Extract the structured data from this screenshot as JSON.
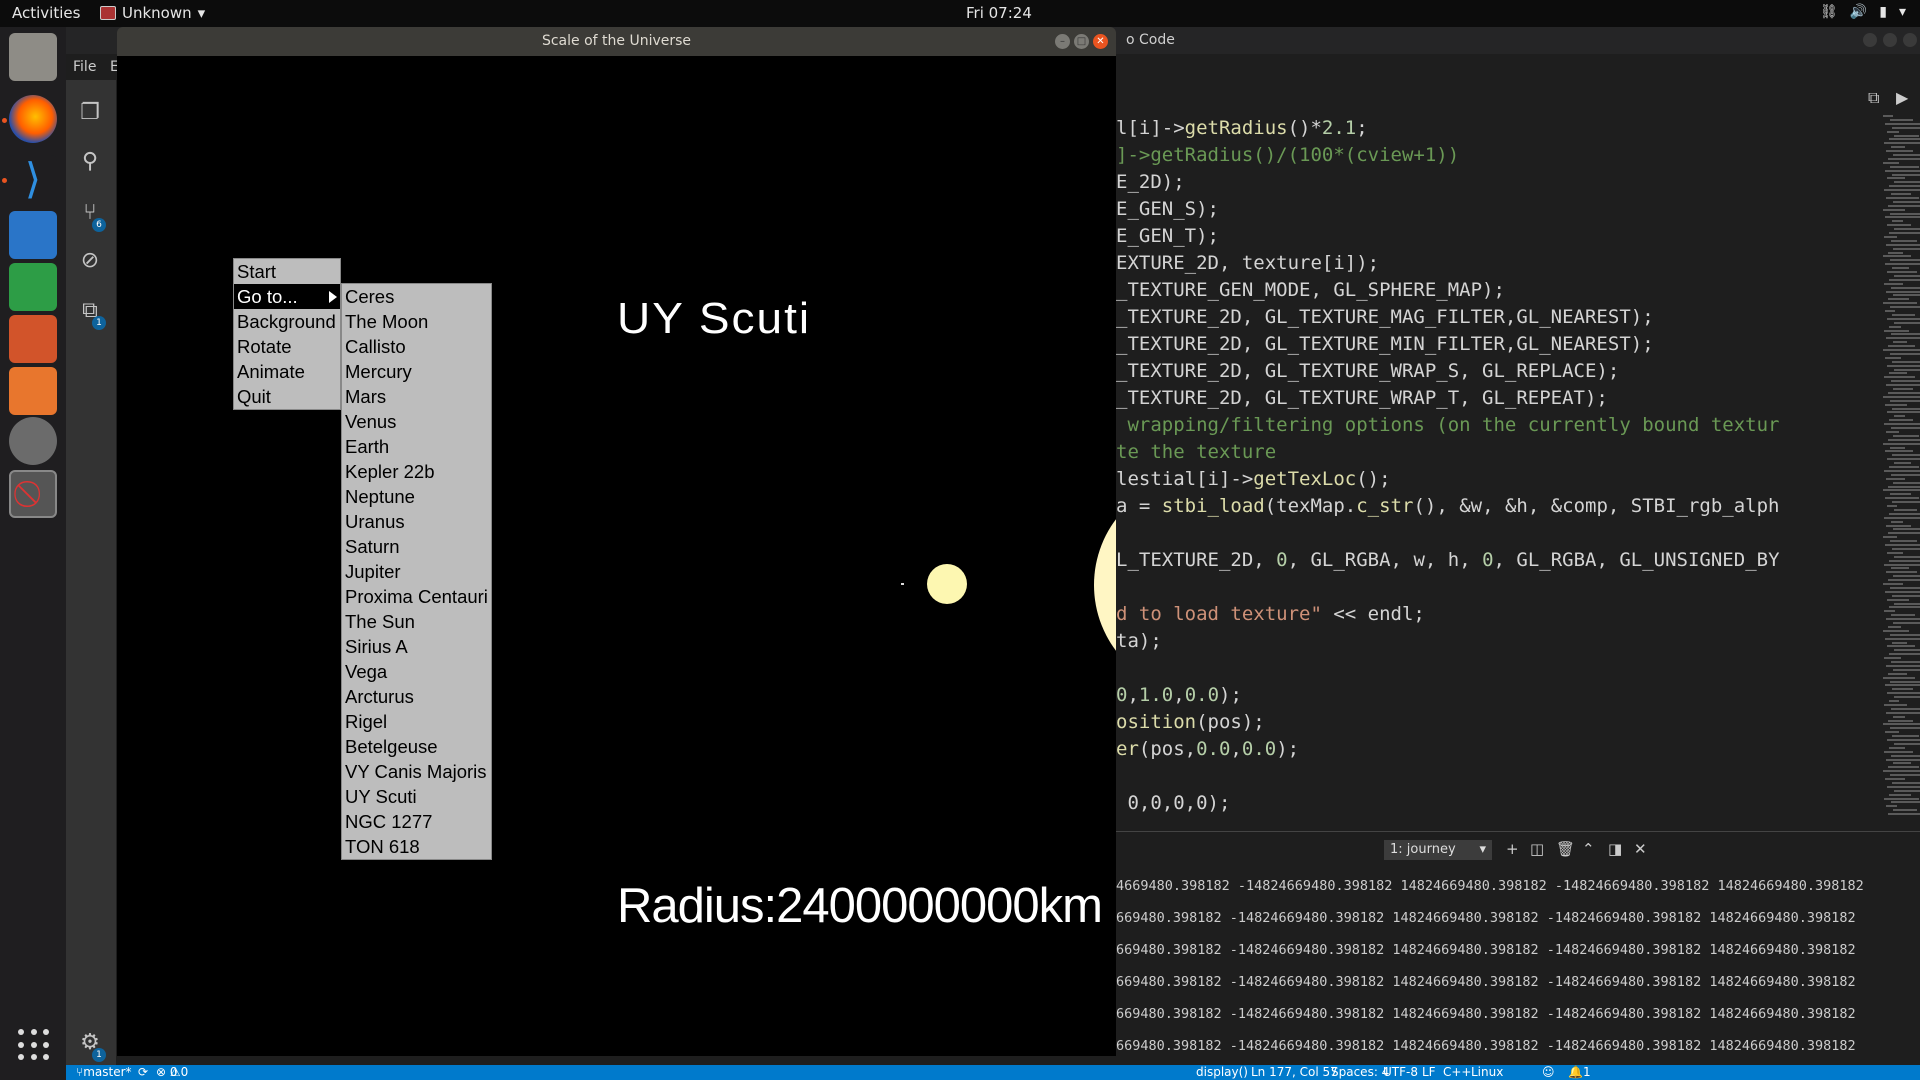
{
  "topbar": {
    "activities": "Activities",
    "app_name": "Unknown",
    "clock": "Fri 07:24",
    "tray": [
      "network-icon",
      "volume-icon",
      "battery-icon",
      "menu-arrow-icon"
    ]
  },
  "dock": {
    "items": [
      "files-icon",
      "firefox-icon",
      "vscode-icon",
      "writer-icon",
      "calc-icon",
      "impress-icon",
      "software-icon",
      "settings-icon",
      "app-blocked-icon"
    ]
  },
  "vscode": {
    "title": "o Code",
    "menu": [
      "File",
      "E"
    ],
    "activity_badges": {
      "source_control": "6",
      "extensions": "1",
      "settings": "1"
    },
    "code_lines": [
      {
        "parts": [
          [
            "plain",
            "l[i]->"
          ],
          [
            "fn",
            "getRadius"
          ],
          [
            "plain",
            "()*"
          ],
          [
            "num",
            "2.1"
          ],
          [
            "plain",
            ";"
          ]
        ]
      },
      {
        "parts": [
          [
            "cm",
            "]->getRadius()/(100*(cview+1))"
          ]
        ]
      },
      {
        "parts": [
          [
            "plain",
            "E_2D);"
          ]
        ]
      },
      {
        "parts": [
          [
            "plain",
            "E_GEN_S);"
          ]
        ]
      },
      {
        "parts": [
          [
            "plain",
            "E_GEN_T);"
          ]
        ]
      },
      {
        "parts": [
          [
            "plain",
            "EXTURE_2D, texture[i]);"
          ]
        ]
      },
      {
        "parts": [
          [
            "plain",
            "_TEXTURE_GEN_MODE, GL_SPHERE_MAP);"
          ]
        ]
      },
      {
        "parts": [
          [
            "plain",
            "_TEXTURE_2D, GL_TEXTURE_MAG_FILTER,GL_NEAREST);"
          ]
        ]
      },
      {
        "parts": [
          [
            "plain",
            "_TEXTURE_2D, GL_TEXTURE_MIN_FILTER,GL_NEAREST);"
          ]
        ]
      },
      {
        "parts": [
          [
            "plain",
            "_TEXTURE_2D, GL_TEXTURE_WRAP_S, GL_REPLACE);"
          ]
        ]
      },
      {
        "parts": [
          [
            "plain",
            "_TEXTURE_2D, GL_TEXTURE_WRAP_T, GL_REPEAT);"
          ]
        ]
      },
      {
        "parts": [
          [
            "cm",
            " wrapping/filtering options (on the currently bound textur"
          ]
        ]
      },
      {
        "parts": [
          [
            "cm",
            "te the texture"
          ]
        ]
      },
      {
        "parts": [
          [
            "plain",
            "lestial[i]->"
          ],
          [
            "fn",
            "getTexLoc"
          ],
          [
            "plain",
            "();"
          ]
        ]
      },
      {
        "parts": [
          [
            "plain",
            "a = "
          ],
          [
            "fn",
            "stbi_load"
          ],
          [
            "plain",
            "(texMap."
          ],
          [
            "fn",
            "c_str"
          ],
          [
            "plain",
            "(), &w, &h, &comp, STBI_rgb_alph"
          ]
        ]
      },
      {
        "parts": [
          [
            "plain",
            ""
          ]
        ]
      },
      {
        "parts": [
          [
            "plain",
            "L_TEXTURE_2D, "
          ],
          [
            "num",
            "0"
          ],
          [
            "plain",
            ", GL_RGBA, w, h, "
          ],
          [
            "num",
            "0"
          ],
          [
            "plain",
            ", GL_RGBA, GL_UNSIGNED_BY"
          ]
        ]
      },
      {
        "parts": [
          [
            "plain",
            ""
          ]
        ]
      },
      {
        "parts": [
          [
            "str",
            "d to load texture\""
          ],
          [
            "plain",
            " << endl;"
          ]
        ]
      },
      {
        "parts": [
          [
            "plain",
            "ta);"
          ]
        ]
      },
      {
        "parts": [
          [
            "plain",
            ""
          ]
        ]
      },
      {
        "parts": [
          [
            "num",
            "0"
          ],
          [
            "plain",
            ","
          ],
          [
            "num",
            "1.0"
          ],
          [
            "plain",
            ","
          ],
          [
            "num",
            "0.0"
          ],
          [
            "plain",
            ");"
          ]
        ]
      },
      {
        "parts": [
          [
            "fn",
            "osition"
          ],
          [
            "plain",
            "(pos);"
          ]
        ]
      },
      {
        "parts": [
          [
            "fn",
            "er"
          ],
          [
            "plain",
            "(pos,"
          ],
          [
            "num",
            "0.0"
          ],
          [
            "plain",
            ","
          ],
          [
            "num",
            "0.0"
          ],
          [
            "plain",
            ");"
          ]
        ]
      },
      {
        "parts": [
          [
            "plain",
            ""
          ]
        ]
      },
      {
        "parts": [
          [
            "plain",
            " 0,0,0,0);"
          ]
        ]
      }
    ],
    "panel": {
      "terminal_select": "1: journey",
      "terminal_lines": [
        "4669480.398182 -14824669480.398182 14824669480.398182 -14824669480.398182 14824669480.398182",
        "669480.398182 -14824669480.398182 14824669480.398182 -14824669480.398182 14824669480.398182",
        "669480.398182 -14824669480.398182 14824669480.398182 -14824669480.398182 14824669480.398182",
        "669480.398182 -14824669480.398182 14824669480.398182 -14824669480.398182 14824669480.398182",
        "669480.398182 -14824669480.398182 14824669480.398182 -14824669480.398182 14824669480.398182",
        "669480.398182 -14824669480.398182 14824669480.398182 -14824669480.398182 14824669480.398182"
      ]
    },
    "status": {
      "branch": "master*",
      "errors": "0",
      "warnings": "0",
      "function": "display()",
      "position": "Ln 177, Col 57",
      "spaces": "Spaces: 4",
      "encoding": "UTF-8",
      "eol": "LF",
      "language": "C++",
      "platform": "Linux",
      "notifications": "1"
    }
  },
  "universe": {
    "title": "Scale of the Universe",
    "object_name": "UY   Scuti",
    "radius_text": "Radius:2400000000km",
    "menu": [
      "Start",
      "Go to...",
      "Background",
      "Rotate",
      "Animate",
      "Quit"
    ],
    "highlighted_menu": "Go to...",
    "submenu": [
      "Ceres",
      "The Moon",
      "Callisto",
      "Mercury",
      "Mars",
      "Venus",
      "Earth",
      "Kepler 22b",
      "Neptune",
      "Uranus",
      "Saturn",
      "Jupiter",
      "Proxima Centauri",
      "The Sun",
      "Sirius A",
      "Vega",
      "Arcturus",
      "Rigel",
      "Betelgeuse",
      "VY Canis Majoris",
      "UY Scuti",
      "NGC 1277",
      "TON 618"
    ],
    "colors": {
      "sun": "#fdf7b1",
      "canvas": "#000000",
      "menu_bg": "#bdbdbd"
    }
  }
}
